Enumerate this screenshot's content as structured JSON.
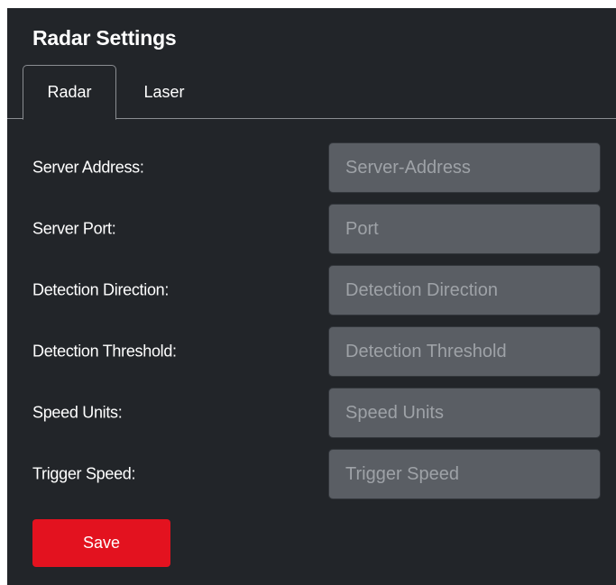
{
  "panel": {
    "title": "Radar Settings"
  },
  "tabs": [
    {
      "label": "Radar",
      "active": true
    },
    {
      "label": "Laser",
      "active": false
    }
  ],
  "fields": [
    {
      "label": "Server Address:",
      "placeholder": "Server-Address",
      "value": ""
    },
    {
      "label": "Server Port:",
      "placeholder": "Port",
      "value": ""
    },
    {
      "label": "Detection Direction:",
      "placeholder": "Detection Direction",
      "value": ""
    },
    {
      "label": "Detection Threshold:",
      "placeholder": "Detection Threshold",
      "value": ""
    },
    {
      "label": "Speed Units:",
      "placeholder": "Speed Units",
      "value": ""
    },
    {
      "label": "Trigger Speed:",
      "placeholder": "Trigger Speed",
      "value": ""
    }
  ],
  "actions": {
    "save_label": "Save"
  },
  "colors": {
    "panel_background": "#222529",
    "input_background": "#5a5e64",
    "save_button": "#e3121f",
    "text": "#ffffff",
    "placeholder": "#9ea2a7"
  }
}
